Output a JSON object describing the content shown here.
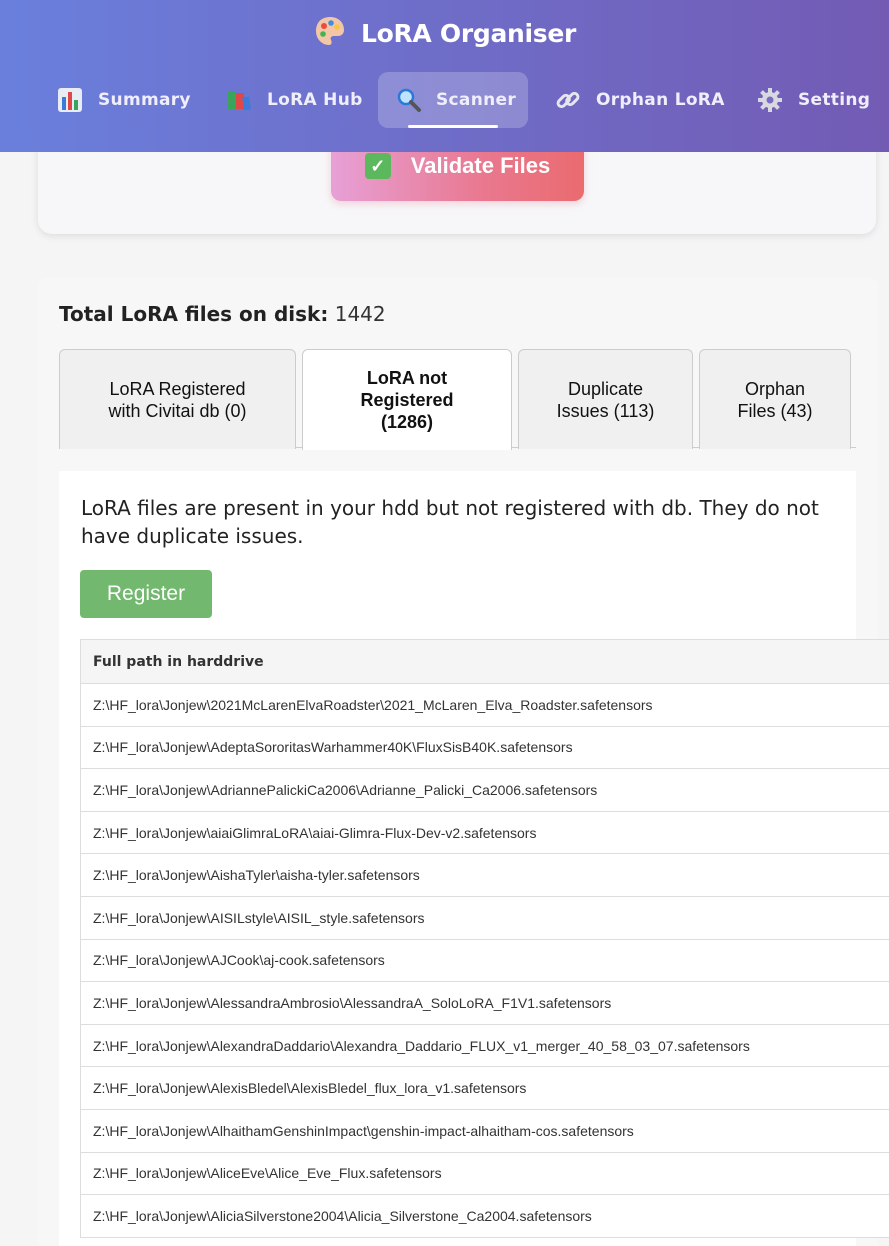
{
  "app": {
    "title": "LoRA Organiser",
    "logo_icon": "palette-icon"
  },
  "nav": [
    {
      "label": "Summary",
      "icon": "bar-chart-icon",
      "active": false
    },
    {
      "label": "LoRA Hub",
      "icon": "books-icon",
      "active": false
    },
    {
      "label": "Scanner",
      "icon": "magnifier-icon",
      "active": true
    },
    {
      "label": "Orphan LoRA",
      "icon": "link-icon",
      "active": false
    },
    {
      "label": "Setting",
      "icon": "gear-icon",
      "active": false
    }
  ],
  "validate": {
    "label": "Validate Files",
    "icon": "check-box-icon"
  },
  "summary": {
    "total_label": "Total LoRA files on disk:",
    "total_value": "1442"
  },
  "tabs": [
    {
      "label": "LoRA Registered with Civitai db (0)",
      "active": false
    },
    {
      "label": "LoRA not Registered (1286)",
      "active": true
    },
    {
      "label": "Duplicate Issues (113)",
      "active": false
    },
    {
      "label": "Orphan Files (43)",
      "active": false
    }
  ],
  "panel": {
    "description": "LoRA files are present in your hdd but not registered with db. They do not have duplicate issues.",
    "register_label": "Register"
  },
  "table": {
    "header": "Full path in harddrive",
    "rows": [
      "Z:\\HF_lora\\Jonjew\\2021McLarenElvaRoadster\\2021_McLaren_Elva_Roadster.safetensors",
      "Z:\\HF_lora\\Jonjew\\AdeptaSororitasWarhammer40K\\FluxSisB40K.safetensors",
      "Z:\\HF_lora\\Jonjew\\AdriannePalickiCa2006\\Adrianne_Palicki_Ca2006.safetensors",
      "Z:\\HF_lora\\Jonjew\\aiaiGlimraLoRA\\aiai-Glimra-Flux-Dev-v2.safetensors",
      "Z:\\HF_lora\\Jonjew\\AishaTyler\\aisha-tyler.safetensors",
      "Z:\\HF_lora\\Jonjew\\AISILstyle\\AISIL_style.safetensors",
      "Z:\\HF_lora\\Jonjew\\AJCook\\aj-cook.safetensors",
      "Z:\\HF_lora\\Jonjew\\AlessandraAmbrosio\\AlessandraA_SoloLoRA_F1V1.safetensors",
      "Z:\\HF_lora\\Jonjew\\AlexandraDaddario\\Alexandra_Daddario_FLUX_v1_merger_40_58_03_07.safetensors",
      "Z:\\HF_lora\\Jonjew\\AlexisBledel\\AlexisBledel_flux_lora_v1.safetensors",
      "Z:\\HF_lora\\Jonjew\\AlhaithamGenshinImpact\\genshin-impact-alhaitham-cos.safetensors",
      "Z:\\HF_lora\\Jonjew\\AliceEve\\Alice_Eve_Flux.safetensors",
      "Z:\\HF_lora\\Jonjew\\AliciaSilverstone2004\\Alicia_Silverstone_Ca2004.safetensors"
    ]
  }
}
